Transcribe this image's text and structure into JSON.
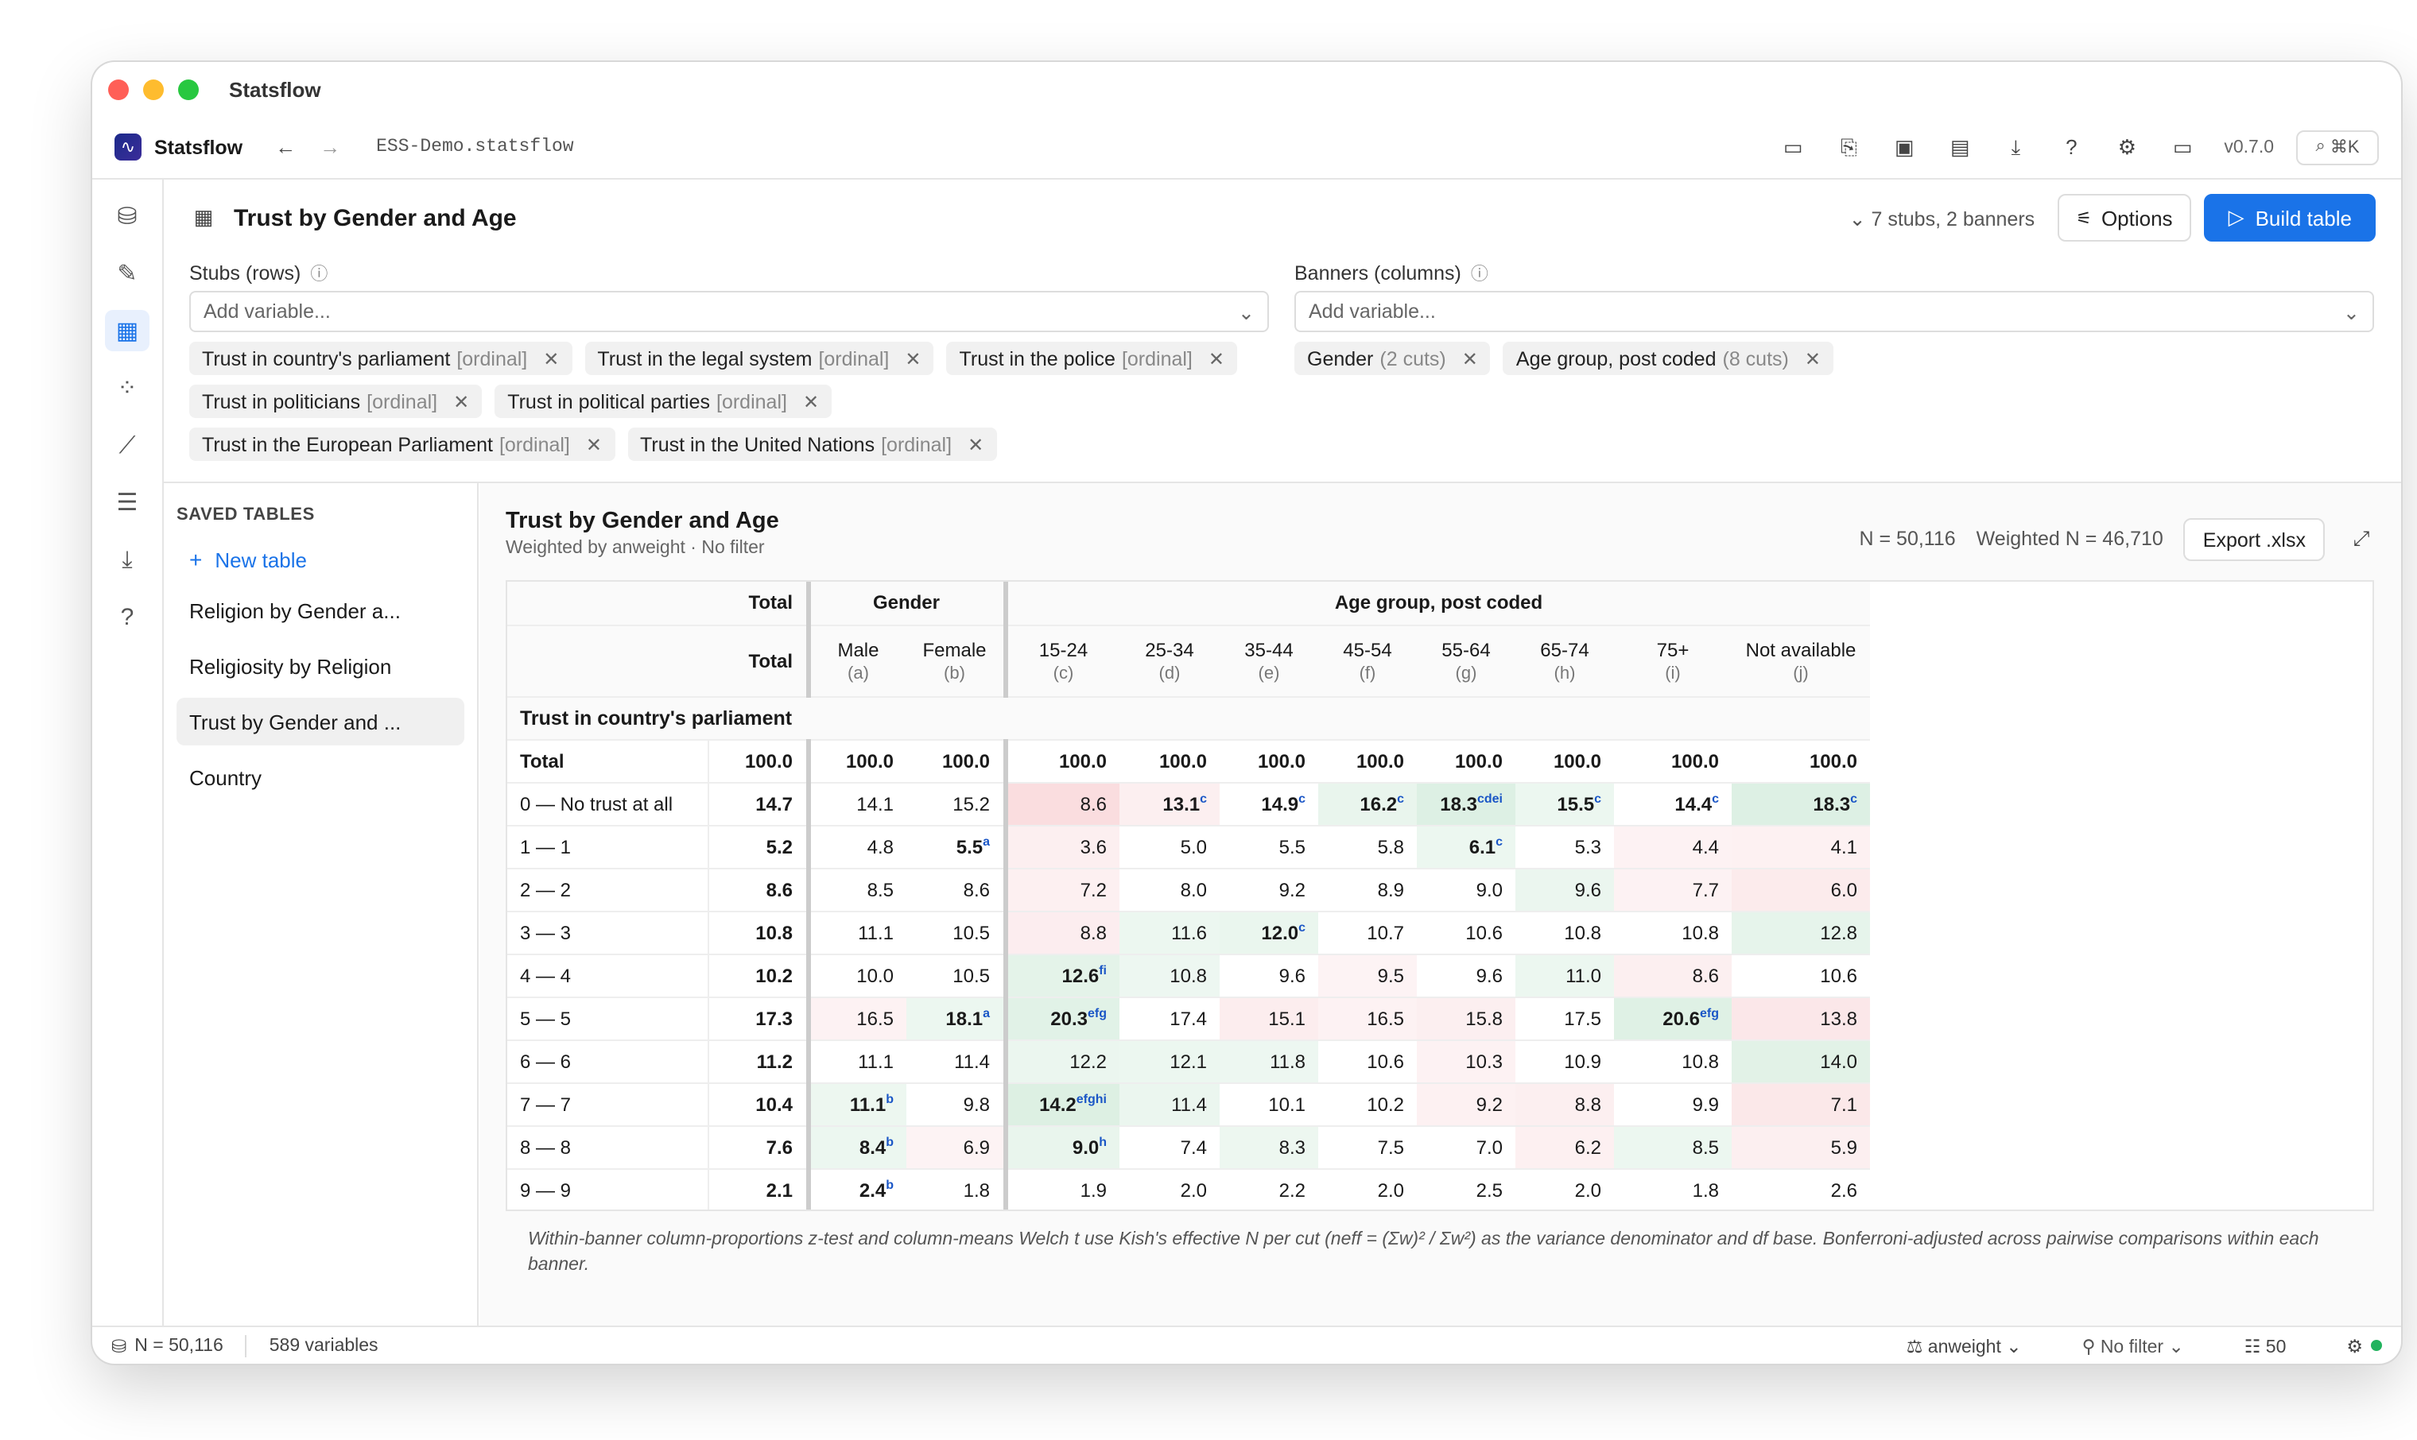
{
  "window": {
    "title": "Statsflow"
  },
  "appbar": {
    "brand": "Statsflow",
    "file": "ESS-Demo.statsflow",
    "version": "v0.7.0",
    "search_shortcut": "⌘K"
  },
  "builder": {
    "title": "Trust by Gender and Age",
    "summary": "7 stubs, 2 banners",
    "options_label": "Options",
    "build_label": "Build table",
    "stubs_label": "Stubs (rows)",
    "banners_label": "Banners (columns)",
    "add_placeholder": "Add variable...",
    "stubs": [
      {
        "name": "Trust in country's parliament",
        "meta": "[ordinal]"
      },
      {
        "name": "Trust in the legal system",
        "meta": "[ordinal]"
      },
      {
        "name": "Trust in the police",
        "meta": "[ordinal]"
      },
      {
        "name": "Trust in politicians",
        "meta": "[ordinal]"
      },
      {
        "name": "Trust in political parties",
        "meta": "[ordinal]"
      },
      {
        "name": "Trust in the European Parliament",
        "meta": "[ordinal]"
      },
      {
        "name": "Trust in the United Nations",
        "meta": "[ordinal]"
      }
    ],
    "banners": [
      {
        "name": "Gender",
        "meta": "(2 cuts)"
      },
      {
        "name": "Age group, post coded",
        "meta": "(8 cuts)"
      }
    ]
  },
  "saved": {
    "heading": "SAVED TABLES",
    "new_label": "New table",
    "items": [
      "Religion by Gender a...",
      "Religiosity by Religion",
      "Trust by Gender and ...",
      "Country"
    ]
  },
  "results": {
    "title": "Trust by Gender and Age",
    "subtitle": "Weighted by anweight · No filter",
    "n": "N = 50,116",
    "wn": "Weighted N = 46,710",
    "export_label": "Export .xlsx",
    "groups": [
      "Total",
      "Gender",
      "Age group, post coded"
    ],
    "columns": [
      {
        "label": "Total",
        "letter": ""
      },
      {
        "label": "Male",
        "letter": "(a)"
      },
      {
        "label": "Female",
        "letter": "(b)"
      },
      {
        "label": "15-24",
        "letter": "(c)"
      },
      {
        "label": "25-34",
        "letter": "(d)"
      },
      {
        "label": "35-44",
        "letter": "(e)"
      },
      {
        "label": "45-54",
        "letter": "(f)"
      },
      {
        "label": "55-64",
        "letter": "(g)"
      },
      {
        "label": "65-74",
        "letter": "(h)"
      },
      {
        "label": "75+",
        "letter": "(i)"
      },
      {
        "label": "Not available",
        "letter": "(j)"
      }
    ],
    "section": "Trust in country's parliament",
    "rows": [
      {
        "label": "Total",
        "cells": [
          "100.0",
          "100.0",
          "100.0",
          "100.0",
          "100.0",
          "100.0",
          "100.0",
          "100.0",
          "100.0",
          "100.0",
          "100.0"
        ],
        "sig": [
          "",
          "",
          "",
          "",
          "",
          "",
          "",
          "",
          "",
          "",
          ""
        ]
      },
      {
        "label": "0 — No trust at all",
        "cells": [
          "14.7",
          "14.1",
          "15.2",
          "8.6",
          "13.1",
          "14.9",
          "16.2",
          "18.3",
          "15.5",
          "14.4",
          "18.3"
        ],
        "sig": [
          "",
          "",
          "",
          "",
          "c",
          "c",
          "c",
          "cdei",
          "c",
          "c",
          "c"
        ]
      },
      {
        "label": "1 — 1",
        "cells": [
          "5.2",
          "4.8",
          "5.5",
          "3.6",
          "5.0",
          "5.5",
          "5.8",
          "6.1",
          "5.3",
          "4.4",
          "4.1"
        ],
        "sig": [
          "",
          "",
          "a",
          "",
          "",
          "",
          "",
          "c",
          "",
          "",
          ""
        ]
      },
      {
        "label": "2 — 2",
        "cells": [
          "8.6",
          "8.5",
          "8.6",
          "7.2",
          "8.0",
          "9.2",
          "8.9",
          "9.0",
          "9.6",
          "7.7",
          "6.0"
        ],
        "sig": [
          "",
          "",
          "",
          "",
          "",
          "",
          "",
          "",
          "",
          "",
          ""
        ]
      },
      {
        "label": "3 — 3",
        "cells": [
          "10.8",
          "11.1",
          "10.5",
          "8.8",
          "11.6",
          "12.0",
          "10.7",
          "10.6",
          "10.8",
          "10.8",
          "12.8"
        ],
        "sig": [
          "",
          "",
          "",
          "",
          "",
          "c",
          "",
          "",
          "",
          "",
          ""
        ]
      },
      {
        "label": "4 — 4",
        "cells": [
          "10.2",
          "10.0",
          "10.5",
          "12.6",
          "10.8",
          "9.6",
          "9.5",
          "9.6",
          "11.0",
          "8.6",
          "10.6"
        ],
        "sig": [
          "",
          "",
          "",
          "fi",
          "",
          "",
          "",
          "",
          "",
          "",
          ""
        ]
      },
      {
        "label": "5 — 5",
        "cells": [
          "17.3",
          "16.5",
          "18.1",
          "20.3",
          "17.4",
          "15.1",
          "16.5",
          "15.8",
          "17.5",
          "20.6",
          "13.8"
        ],
        "sig": [
          "",
          "",
          "a",
          "efg",
          "",
          "",
          "",
          "",
          "",
          "efg",
          ""
        ]
      },
      {
        "label": "6 — 6",
        "cells": [
          "11.2",
          "11.1",
          "11.4",
          "12.2",
          "12.1",
          "11.8",
          "10.6",
          "10.3",
          "10.9",
          "10.8",
          "14.0"
        ],
        "sig": [
          "",
          "",
          "",
          "",
          "",
          "",
          "",
          "",
          "",
          "",
          ""
        ]
      },
      {
        "label": "7 — 7",
        "cells": [
          "10.4",
          "11.1",
          "9.8",
          "14.2",
          "11.4",
          "10.1",
          "10.2",
          "9.2",
          "8.8",
          "9.9",
          "7.1"
        ],
        "sig": [
          "",
          "b",
          "",
          "efghi",
          "",
          "",
          "",
          "",
          "",
          "",
          ""
        ]
      },
      {
        "label": "8 — 8",
        "cells": [
          "7.6",
          "8.4",
          "6.9",
          "9.0",
          "7.4",
          "8.3",
          "7.5",
          "7.0",
          "6.2",
          "8.5",
          "5.9"
        ],
        "sig": [
          "",
          "b",
          "",
          "h",
          "",
          "",
          "",
          "",
          "",
          "",
          ""
        ]
      },
      {
        "label": "9 — 9",
        "cells": [
          "2.1",
          "2.4",
          "1.8",
          "1.9",
          "2.0",
          "2.2",
          "2.0",
          "2.5",
          "2.0",
          "1.8",
          "2.6"
        ],
        "sig": [
          "",
          "b",
          "",
          "",
          "",
          "",
          "",
          "",
          "",
          "",
          ""
        ]
      }
    ],
    "footnote": "Within-banner column-proportions z-test and column-means Welch t use Kish's effective N per cut (neff = (Σw)² / Σw²) as the variance denominator and df base. Bonferroni-adjusted across pairwise comparisons within each banner."
  },
  "status": {
    "n": "N = 50,116",
    "vars": "589 variables",
    "weight": "anweight",
    "filter": "No filter",
    "count": "50"
  },
  "colors": {
    "accent": "#1a73e8",
    "sig": "#1a56c6"
  }
}
